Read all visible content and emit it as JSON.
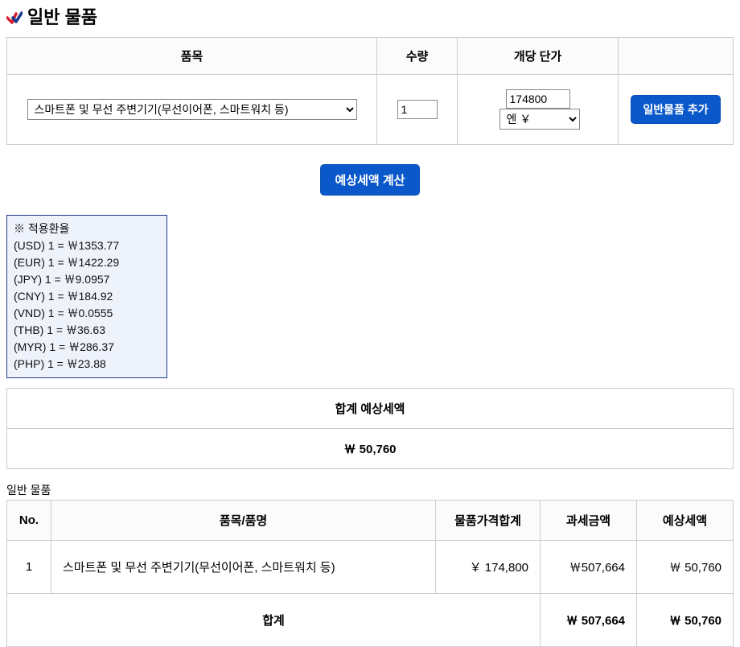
{
  "page_title": "일반 물품",
  "input_headers": {
    "item": "품목",
    "qty": "수량",
    "unit_price": "개당 단가",
    "action": ""
  },
  "input_row": {
    "item_option": "스마트폰 및 무선 주변기기(무선이어폰, 스마트워치 등)",
    "qty_value": "1",
    "price_value": "174800",
    "currency_option": "엔 ￥",
    "add_button": "일반물품 추가"
  },
  "calc_button": "예상세액 계산",
  "rate_box": {
    "title": "※ 적용환율",
    "rates": [
      "(USD) 1 = ￦1353.77",
      "(EUR) 1 = ￦1422.29",
      "(JPY) 1 = ￦9.0957",
      "(CNY) 1 = ￦184.92",
      "(VND) 1 = ￦0.0555",
      "(THB) 1 = ￦36.63",
      "(MYR) 1 = ￦286.37",
      "(PHP) 1 = ￦23.88"
    ]
  },
  "summary": {
    "header": "합계 예상세액",
    "value": "￦ 50,760"
  },
  "section_label": "일반 물품",
  "result_headers": {
    "no": "No.",
    "name": "품목/품명",
    "price_total": "물품가격합계",
    "tax_base": "과세금액",
    "est_tax": "예상세액"
  },
  "result_row": {
    "no": "1",
    "name": "스마트폰 및 무선 주변기기(무선이어폰, 스마트워치 등)",
    "price_total": "￥ 174,800",
    "tax_base": "￦507,664",
    "est_tax": "￦ 50,760"
  },
  "result_total": {
    "label": "합계",
    "tax_base": "￦ 507,664",
    "est_tax": "￦ 50,760"
  }
}
